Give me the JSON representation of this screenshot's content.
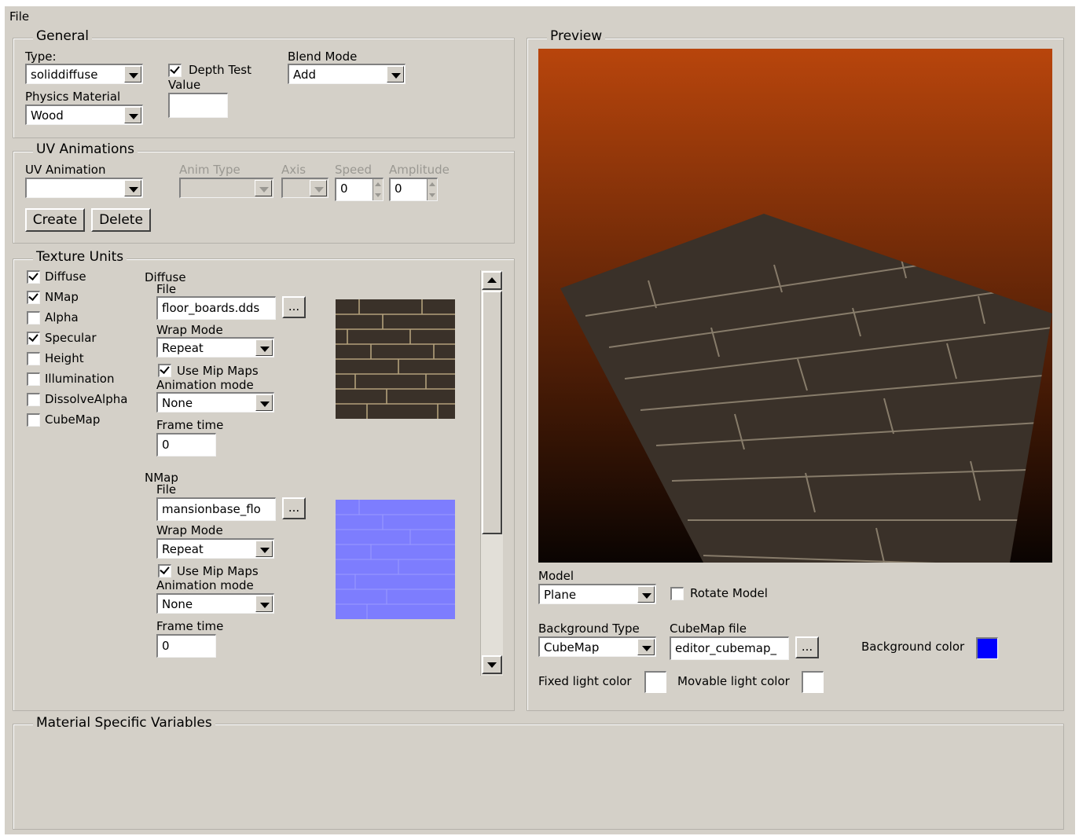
{
  "menu": {
    "file": "File"
  },
  "general": {
    "title": "General",
    "type_label": "Type:",
    "type_value": "soliddiffuse",
    "depth_test_label": "Depth Test",
    "depth_test_checked": true,
    "value_label": "Value",
    "value_value": "",
    "blend_mode_label": "Blend Mode",
    "blend_mode_value": "Add",
    "physics_material_label": "Physics Material",
    "physics_material_value": "Wood"
  },
  "uv": {
    "title": "UV Animations",
    "uv_animation_label": "UV Animation",
    "uv_animation_value": "",
    "anim_type_label": "Anim Type",
    "axis_label": "Axis",
    "speed_label": "Speed",
    "speed_value": "0",
    "amplitude_label": "Amplitude",
    "amplitude_value": "0",
    "create_label": "Create",
    "delete_label": "Delete"
  },
  "texture_units": {
    "title": "Texture Units",
    "units": [
      {
        "label": "Diffuse",
        "checked": true
      },
      {
        "label": "NMap",
        "checked": true
      },
      {
        "label": "Alpha",
        "checked": false
      },
      {
        "label": "Specular",
        "checked": true
      },
      {
        "label": "Height",
        "checked": false
      },
      {
        "label": "Illumination",
        "checked": false
      },
      {
        "label": "DissolveAlpha",
        "checked": false
      },
      {
        "label": "CubeMap",
        "checked": false
      }
    ],
    "diffuse": {
      "heading": "Diffuse",
      "file_label": "File",
      "file_value": "floor_boards.dds",
      "browse_label": "...",
      "wrap_label": "Wrap Mode",
      "wrap_value": "Repeat",
      "mip_label": "Use Mip Maps",
      "mip_checked": true,
      "anim_mode_label": "Animation mode",
      "anim_mode_value": "None",
      "frame_time_label": "Frame time",
      "frame_time_value": "0"
    },
    "nmap": {
      "heading": "NMap",
      "file_label": "File",
      "file_value": "mansionbase_flo",
      "browse_label": "...",
      "wrap_label": "Wrap Mode",
      "wrap_value": "Repeat",
      "mip_label": "Use Mip Maps",
      "mip_checked": true,
      "anim_mode_label": "Animation mode",
      "anim_mode_value": "None",
      "frame_time_label": "Frame time",
      "frame_time_value": "0"
    }
  },
  "preview": {
    "title": "Preview",
    "model_label": "Model",
    "model_value": "Plane",
    "rotate_label": "Rotate Model",
    "rotate_checked": false,
    "bg_type_label": "Background Type",
    "bg_type_value": "CubeMap",
    "cubemap_label": "CubeMap file",
    "cubemap_value": "editor_cubemap_",
    "browse_label": "...",
    "bg_color_label": "Background color",
    "bg_color": "#0000ff",
    "fixed_light_label": "Fixed light color",
    "fixed_light_color": "#ffffff",
    "movable_light_label": "Movable light color",
    "movable_light_color": "#ffffff"
  },
  "msv": {
    "title": "Material Specific Variables"
  },
  "colors": {
    "window_bg": "#d4d0c8",
    "sky_top": "#b8450c",
    "sky_bottom": "#0a0402",
    "wood": "#3a3129",
    "normal_map": "#7d7dfe"
  }
}
